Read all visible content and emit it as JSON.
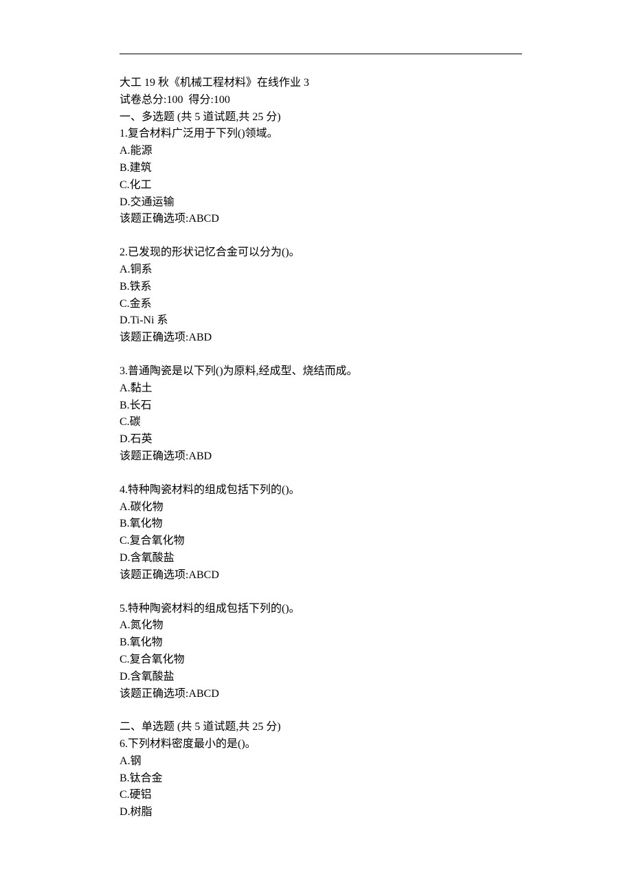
{
  "header": {
    "title": "大工 19 秋《机械工程材料》在线作业 3",
    "score_line": "试卷总分:100  得分:100"
  },
  "sections": [
    {
      "heading": "一、多选题 (共 5 道试题,共 25 分)",
      "questions": [
        {
          "number": "1",
          "stem": "复合材料广泛用于下列()领域。",
          "options": [
            {
              "label": "A",
              "text": "能源"
            },
            {
              "label": "B",
              "text": "建筑"
            },
            {
              "label": "C",
              "text": "化工"
            },
            {
              "label": "D",
              "text": "交通运输"
            }
          ],
          "answer_label": "该题正确选项:",
          "answer": "ABCD"
        },
        {
          "number": "2",
          "stem": "已发现的形状记忆合金可以分为()。",
          "options": [
            {
              "label": "A",
              "text": "铜系"
            },
            {
              "label": "B",
              "text": "铁系"
            },
            {
              "label": "C",
              "text": "金系"
            },
            {
              "label": "D",
              "text": "Ti-Ni 系"
            }
          ],
          "answer_label": "该题正确选项:",
          "answer": "ABD"
        },
        {
          "number": "3",
          "stem": "普通陶瓷是以下列()为原料,经成型、烧结而成。",
          "options": [
            {
              "label": "A",
              "text": "黏土"
            },
            {
              "label": "B",
              "text": "长石"
            },
            {
              "label": "C",
              "text": "碳"
            },
            {
              "label": "D",
              "text": "石英"
            }
          ],
          "answer_label": "该题正确选项:",
          "answer": "ABD"
        },
        {
          "number": "4",
          "stem": "特种陶瓷材料的组成包括下列的()。",
          "options": [
            {
              "label": "A",
              "text": "碳化物"
            },
            {
              "label": "B",
              "text": "氧化物"
            },
            {
              "label": "C",
              "text": "复合氧化物"
            },
            {
              "label": "D",
              "text": "含氧酸盐"
            }
          ],
          "answer_label": "该题正确选项:",
          "answer": "ABCD"
        },
        {
          "number": "5",
          "stem": "特种陶瓷材料的组成包括下列的()。",
          "options": [
            {
              "label": "A",
              "text": "氮化物"
            },
            {
              "label": "B",
              "text": "氧化物"
            },
            {
              "label": "C",
              "text": "复合氧化物"
            },
            {
              "label": "D",
              "text": "含氧酸盐"
            }
          ],
          "answer_label": "该题正确选项:",
          "answer": "ABCD"
        }
      ]
    },
    {
      "heading": "二、单选题 (共 5 道试题,共 25 分)",
      "questions": [
        {
          "number": "6",
          "stem": "下列材料密度最小的是()。",
          "options": [
            {
              "label": "A",
              "text": "钢"
            },
            {
              "label": "B",
              "text": "钛合金"
            },
            {
              "label": "C",
              "text": "硬铝"
            },
            {
              "label": "D",
              "text": "树脂"
            }
          ],
          "answer_label": "",
          "answer": ""
        }
      ]
    }
  ]
}
